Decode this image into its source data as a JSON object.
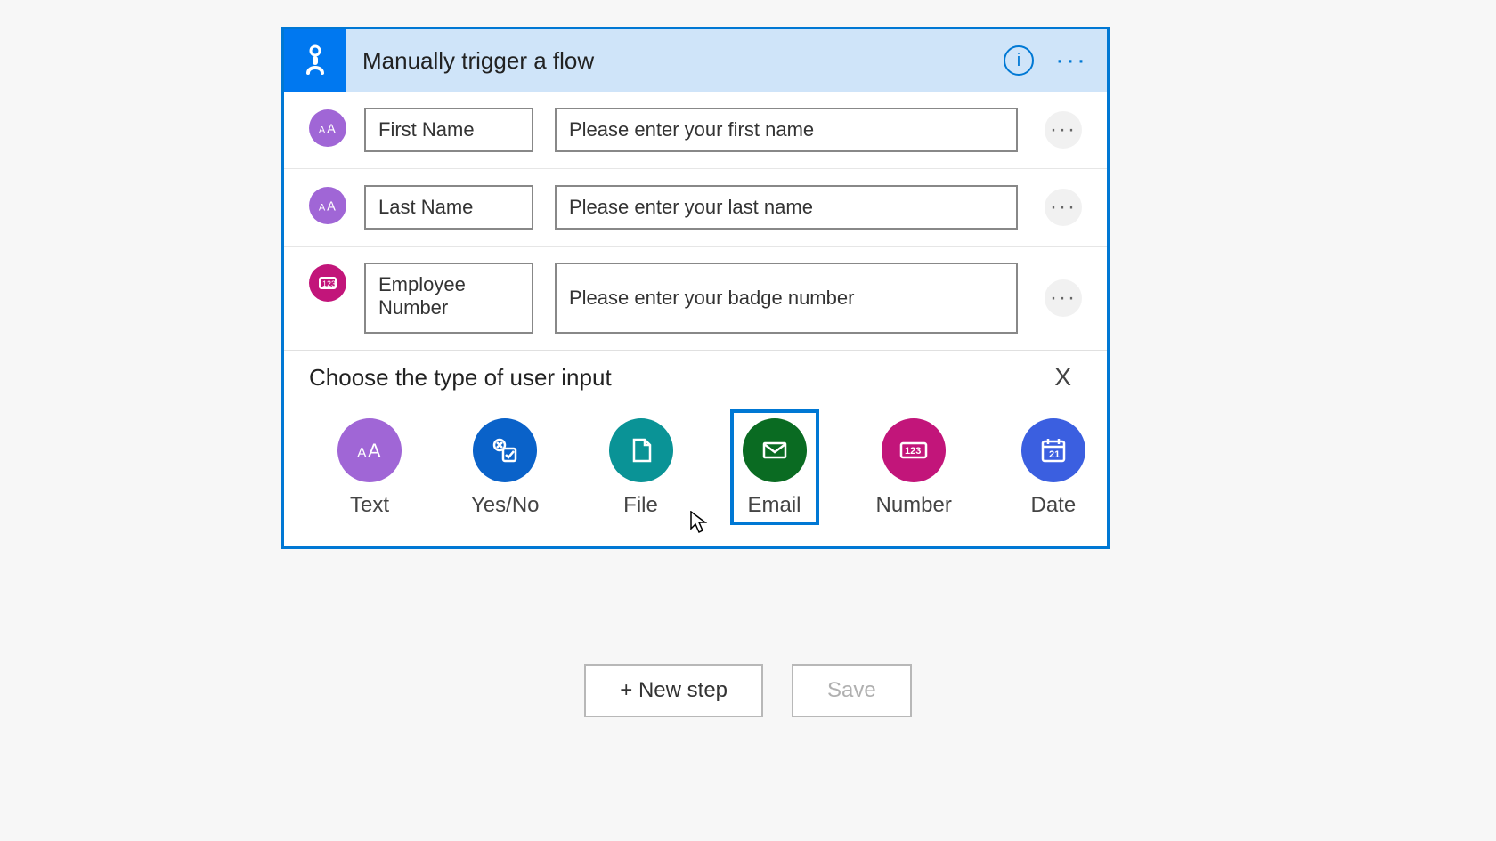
{
  "header": {
    "title": "Manually trigger a flow"
  },
  "inputs": [
    {
      "icon": "text",
      "name": "First Name",
      "prompt": "Please enter your first name"
    },
    {
      "icon": "text",
      "name": "Last Name",
      "prompt": "Please enter your last name"
    },
    {
      "icon": "number",
      "name": "Employee Number",
      "prompt": "Please enter your badge number"
    }
  ],
  "chooser": {
    "title": "Choose the type of user input",
    "close_label": "X",
    "options": [
      {
        "key": "text",
        "label": "Text",
        "selected": false
      },
      {
        "key": "yesno",
        "label": "Yes/No",
        "selected": false
      },
      {
        "key": "file",
        "label": "File",
        "selected": false
      },
      {
        "key": "email",
        "label": "Email",
        "selected": true
      },
      {
        "key": "number",
        "label": "Number",
        "selected": false
      },
      {
        "key": "date",
        "label": "Date",
        "selected": false
      }
    ]
  },
  "footer": {
    "new_step": "+ New step",
    "save": "Save"
  },
  "colors": {
    "accent": "#0078d4"
  }
}
